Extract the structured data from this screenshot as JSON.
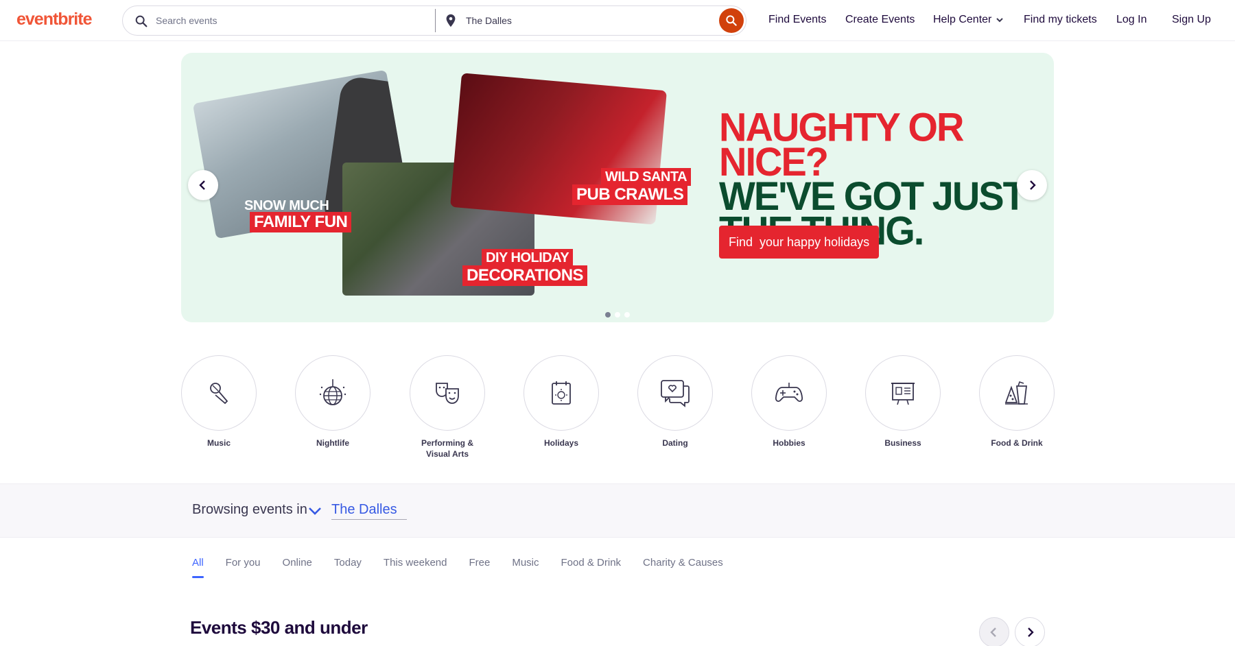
{
  "header": {
    "logo": "eventbrite",
    "search_placeholder": "Search events",
    "location_value": "The Dalles",
    "nav": {
      "find_events": "Find Events",
      "create_events": "Create Events",
      "help_center": "Help Center",
      "find_tickets": "Find my tickets",
      "log_in": "Log In",
      "sign_up": "Sign Up"
    }
  },
  "hero": {
    "headline_line1": "NAUGHTY OR NICE?",
    "headline_line2": "WE'VE GOT JUST",
    "headline_line3": "THE THING.",
    "cta": "Find  your happy holidays",
    "tags": {
      "snow_top": "SNOW MUCH",
      "snow_bottom": "FAMILY FUN",
      "santa_top": "WILD SANTA",
      "santa_bottom": "PUB CRAWLS",
      "diy_top": "DIY HOLIDAY",
      "diy_bottom": "DECORATIONS"
    },
    "slide_count": 3,
    "active_slide": 1
  },
  "categories": [
    {
      "label": "Music",
      "icon": "microphone-icon"
    },
    {
      "label": "Nightlife",
      "icon": "disco-ball-icon"
    },
    {
      "label": "Performing & Visual Arts",
      "icon": "theater-masks-icon"
    },
    {
      "label": "Holidays",
      "icon": "calendar-icon"
    },
    {
      "label": "Dating",
      "icon": "chat-heart-icon"
    },
    {
      "label": "Hobbies",
      "icon": "gamepad-icon"
    },
    {
      "label": "Business",
      "icon": "presentation-icon"
    },
    {
      "label": "Food & Drink",
      "icon": "food-drink-icon"
    }
  ],
  "browse": {
    "label": "Browsing events in",
    "location": "The Dalles"
  },
  "tabs": [
    "All",
    "For you",
    "Online",
    "Today",
    "This weekend",
    "Free",
    "Music",
    "Food & Drink",
    "Charity & Causes"
  ],
  "active_tab": "All",
  "section": {
    "title": "Events $30 and under"
  },
  "colors": {
    "brand": "#f05537",
    "accent_blue": "#3d64ff",
    "hero_bg": "#e7f7ee",
    "hero_red": "#e5252f",
    "hero_green": "#0b4c2e"
  }
}
